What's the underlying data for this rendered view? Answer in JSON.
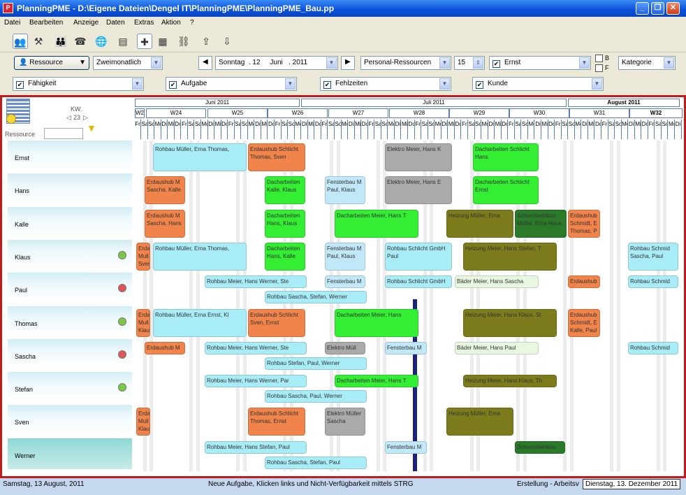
{
  "window": {
    "title": "PlanningPME - D:\\Eigene Dateien\\Dengel IT\\PlanningPME\\PlanningPME_Bau.pp"
  },
  "menu": [
    "Datei",
    "Bearbeiten",
    "Anzeige",
    "Daten",
    "Extras",
    "Aktion",
    "?"
  ],
  "toolbar_icons": [
    "resources-icon",
    "tools-icon",
    "users-icon",
    "phone-icon",
    "globe-icon",
    "calendar-icon",
    "add-task-icon",
    "grid-icon",
    "link-icon",
    "export-icon",
    "import-icon"
  ],
  "controls": {
    "resource_button": "Ressource",
    "view_mode": "Zweimonatlich",
    "date": {
      "weekday": "Sonntag",
      "day": ". 12",
      "month": "Juni",
      "year": ". 2011"
    },
    "resource_type": "Personal-Ressourcen",
    "count": "15",
    "person_filter": "Ernst",
    "b_label": "B",
    "f_label": "F",
    "category": "Kategorie",
    "filters": [
      "Fähigkeit",
      "Aufgabe",
      "Fehlzeiten",
      "Kunde"
    ]
  },
  "left_header": {
    "kw_label": "KW.",
    "kw_value": "23",
    "resource_label": "Ressource"
  },
  "months": [
    {
      "label": "Juni 2011"
    },
    {
      "label": "Juli 2011"
    },
    {
      "label": "August 2011",
      "bold": true
    }
  ],
  "weeks": [
    "W2",
    "W24",
    "W25",
    "W26",
    "W27",
    "W28",
    "W29",
    "W30",
    "W31",
    "W32"
  ],
  "day_labels": [
    "So",
    "Mo",
    "Di",
    "Mi",
    "Do",
    "Fr",
    "Sa"
  ],
  "resources": [
    {
      "name": "Ernst",
      "status": ""
    },
    {
      "name": "Hans",
      "status": ""
    },
    {
      "name": "Kalle",
      "status": ""
    },
    {
      "name": "Klaus",
      "status": "#7ac943"
    },
    {
      "name": "Paul",
      "status": "#e05555"
    },
    {
      "name": "Thomas",
      "status": "#7ac943"
    },
    {
      "name": "Sascha",
      "status": "#e05555"
    },
    {
      "name": "Stefan",
      "status": "#7ac943"
    },
    {
      "name": "Sven",
      "status": ""
    },
    {
      "name": "Werner",
      "status": ""
    }
  ],
  "colors": {
    "rohbau": "#a8ecf8",
    "erdaushub": "#f0844a",
    "dach": "#33ee33",
    "elektro": "#aaaaaa",
    "heizung": "#7c7c1c",
    "schornstein": "#2a7a2a",
    "fenster": "#c0e8f8",
    "bad": "#e8f8e0"
  },
  "tasks": [
    {
      "text": "Rohbau Müller, Erna Thomas,",
      "color": "rohbau"
    },
    {
      "text": "Erdaushub Schlicht Thomas, Sven",
      "color": "erdaushub"
    },
    {
      "text": "Elektro Meier, Hans K",
      "color": "elektro"
    },
    {
      "text": "Dacharbeiten Schlicht Hans",
      "color": "dach"
    },
    {
      "text": "Erdaushub M Sascha, Kalle",
      "color": "erdaushub"
    },
    {
      "text": "Dacharbeiten Kalle, Klaus",
      "color": "dach"
    },
    {
      "text": "Fensterbau M Paul, Klaus",
      "color": "fenster"
    },
    {
      "text": "Elektro Meier, Hans E",
      "color": "elektro"
    },
    {
      "text": "Dacharbeiten Schlicht Ernst",
      "color": "dach"
    },
    {
      "text": "Erdaushub M Sascha, Hans",
      "color": "erdaushub"
    },
    {
      "text": "Dacharbeiten Hans, Klaus",
      "color": "dach"
    },
    {
      "text": "Dacharbeiten Meier, Hans T",
      "color": "dach"
    },
    {
      "text": "Heizung Müller, Erna",
      "color": "heizung"
    },
    {
      "text": "Schornsteinbau Müller, Erna Hans",
      "color": "schornstein"
    },
    {
      "text": "Erdaushub Schmidt, E Thomas, P",
      "color": "erdaushub"
    },
    {
      "text": "Erda Mull Sven",
      "color": "erdaushub"
    },
    {
      "text": "Rohbau Müller, Erna Thomas,",
      "color": "rohbau"
    },
    {
      "text": "Dacharbeiten Hans, Kalle",
      "color": "dach"
    },
    {
      "text": "Fensterbau M Paul, Klaus",
      "color": "fenster"
    },
    {
      "text": "Rohbau Schlicht GmbH Paul",
      "color": "rohbau"
    },
    {
      "text": "Heizung Meier, Hans Stefan, T",
      "color": "heizung"
    },
    {
      "text": "Rohbau Schmid Sascha, Paul",
      "color": "rohbau"
    },
    {
      "text": "Rohbau Meier, Hans Werner, Ste",
      "color": "rohbau"
    },
    {
      "text": "Fensterbau M",
      "color": "fenster"
    },
    {
      "text": "Rohbau Schlicht GmbH",
      "color": "rohbau"
    },
    {
      "text": "Bäder Meier, Hans Sascha",
      "color": "bad"
    },
    {
      "text": "Erdaushub",
      "color": "erdaushub"
    },
    {
      "text": "Rohbau Schmid",
      "color": "rohbau"
    },
    {
      "text": "Rohbau Sascha, Stefan, Werner",
      "color": "rohbau"
    },
    {
      "text": "Erda Mull Klau",
      "color": "erdaushub"
    },
    {
      "text": "Rohbau Müller, Erna Ernst, Kl",
      "color": "rohbau"
    },
    {
      "text": "Erdaushub Schlicht Sven, Ernst",
      "color": "erdaushub"
    },
    {
      "text": "Dacharbeiten Meier, Hans",
      "color": "dach"
    },
    {
      "text": "Heizung Meier, Hans Klaus, St",
      "color": "heizung"
    },
    {
      "text": "Erdaushub Schmidt, E Kalle, Paul",
      "color": "erdaushub"
    },
    {
      "text": "Erdaushub M",
      "color": "erdaushub"
    },
    {
      "text": "Rohbau Meier, Hans Werner, Ste",
      "color": "rohbau"
    },
    {
      "text": "Elektro Müll",
      "color": "elektro"
    },
    {
      "text": "Fensterbau M",
      "color": "fenster"
    },
    {
      "text": "Bäder Meier, Hans Paul",
      "color": "bad"
    },
    {
      "text": "Rohbau Schmid",
      "color": "rohbau"
    },
    {
      "text": "Rohbau Stefan, Paul, Werner",
      "color": "rohbau"
    },
    {
      "text": "Rohbau Meier, Hans Werner, Par",
      "color": "rohbau"
    },
    {
      "text": "Dacharbeiten Meier, Hans T",
      "color": "dach"
    },
    {
      "text": "Heizung Meier, Hans Klaus, Th",
      "color": "heizung"
    },
    {
      "text": "Rohbau Sascha, Paul, Werner",
      "color": "rohbau"
    },
    {
      "text": "Erda Mull Klau",
      "color": "erdaushub"
    },
    {
      "text": "Erdaushub Schlicht Thomas, Ernst",
      "color": "erdaushub"
    },
    {
      "text": "Elektro Müller Sascha",
      "color": "elektro"
    },
    {
      "text": "Heizung Müller, Erna",
      "color": "heizung"
    },
    {
      "text": "Rohbau Meier, Hans Stefan, Paul",
      "color": "rohbau"
    },
    {
      "text": "Fensterbau M",
      "color": "fenster"
    },
    {
      "text": "Schornsteinbau",
      "color": "schornstein"
    },
    {
      "text": "Rohbau Sascha, Stefan, Paul",
      "color": "rohbau"
    }
  ],
  "status": {
    "left": "Samstag, 13 August, 2011",
    "middle": "Neue Aufgabe, Klicken links und Nicht-Verfügbarkeit mittels STRG",
    "right": "Erstellung - Arbeitsv",
    "date": "Dienstag, 13. Dezember 2011"
  }
}
